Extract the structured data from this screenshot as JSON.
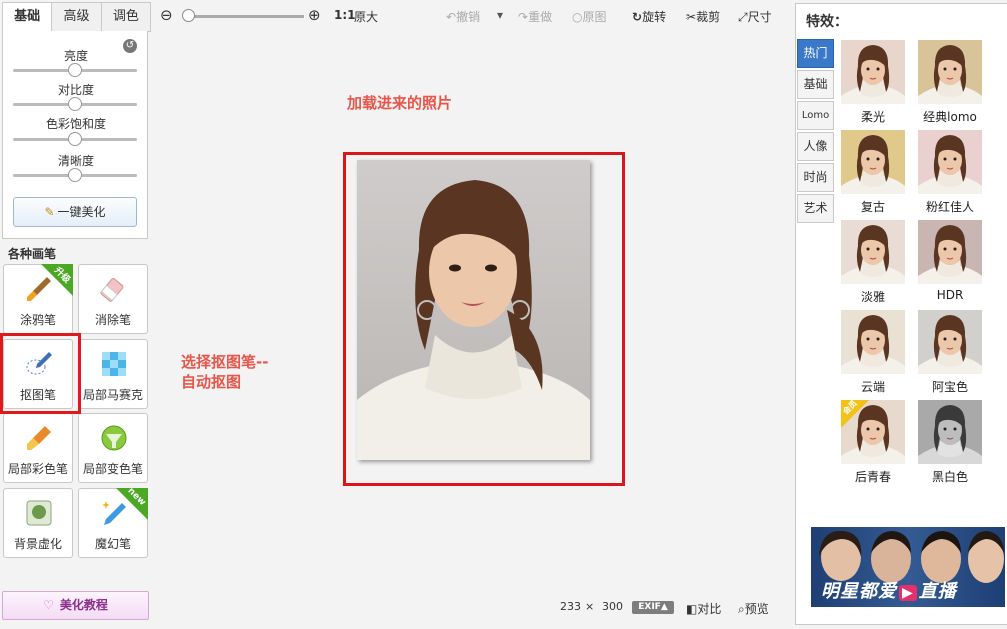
{
  "tabs": [
    "基础",
    "高级",
    "调色"
  ],
  "adjust": {
    "sliders": [
      {
        "label": "亮度",
        "value": 0.5
      },
      {
        "label": "对比度",
        "value": 0.5
      },
      {
        "label": "色彩饱和度",
        "value": 0.5
      },
      {
        "label": "清晰度",
        "value": 0.5
      }
    ],
    "auto_button": "一键美化"
  },
  "brushes": {
    "title": "各种画笔",
    "items": [
      {
        "label": "涂鸦笔",
        "icon": "brush-icon",
        "badge": "升级"
      },
      {
        "label": "消除笔",
        "icon": "eraser-icon"
      },
      {
        "label": "抠图笔",
        "icon": "cutout-pen-icon"
      },
      {
        "label": "局部马赛克",
        "icon": "mosaic-icon"
      },
      {
        "label": "局部彩色笔",
        "icon": "color-brush-icon"
      },
      {
        "label": "局部变色笔",
        "icon": "color-change-icon"
      },
      {
        "label": "背景虚化",
        "icon": "blur-icon"
      },
      {
        "label": "魔幻笔",
        "icon": "magic-pen-icon",
        "badge": "new"
      }
    ]
  },
  "tutorial": "美化教程",
  "toolbar": {
    "ratio": "1:1",
    "original_size": "原大",
    "undo": "撤销",
    "redo": "重做",
    "original": "原图",
    "rotate": "旋转",
    "crop": "裁剪",
    "size": "尺寸"
  },
  "notes": {
    "photo_loaded": "加载进来的照片",
    "cutout_line1": "选择抠图笔--",
    "cutout_line2": "自动抠图"
  },
  "status": {
    "width": "233",
    "times": "×",
    "height": "300",
    "exif": "EXIF▲",
    "compare": "对比",
    "preview": "预览"
  },
  "effects": {
    "title": "特效：",
    "tabs": [
      "热门",
      "基础",
      "Lomo",
      "人像",
      "时尚",
      "艺术"
    ],
    "items": [
      {
        "name": "柔光",
        "tone": "#e8d6cc"
      },
      {
        "name": "经典lomo",
        "tone": "#d9c49a"
      },
      {
        "name": "复古",
        "tone": "#e0c98a"
      },
      {
        "name": "粉红佳人",
        "tone": "#ead0cf"
      },
      {
        "name": "淡雅",
        "tone": "#e8dcd4"
      },
      {
        "name": "HDR",
        "tone": "#c9b5b1"
      },
      {
        "name": "云端",
        "tone": "#e9e1d4"
      },
      {
        "name": "阿宝色",
        "tone": "#d2d0cc"
      },
      {
        "name": "后青春",
        "tone": "#e7d9cc",
        "badge": "会员"
      },
      {
        "name": "黑白色",
        "tone": "#a9a9a9"
      }
    ]
  },
  "ad": {
    "text_left": "明星都爱",
    "text_mid": "▶",
    "text_right": "直播"
  },
  "colors": {
    "accent": "#3a78c9",
    "highlight": "#e0191b",
    "note": "#e8564a"
  }
}
